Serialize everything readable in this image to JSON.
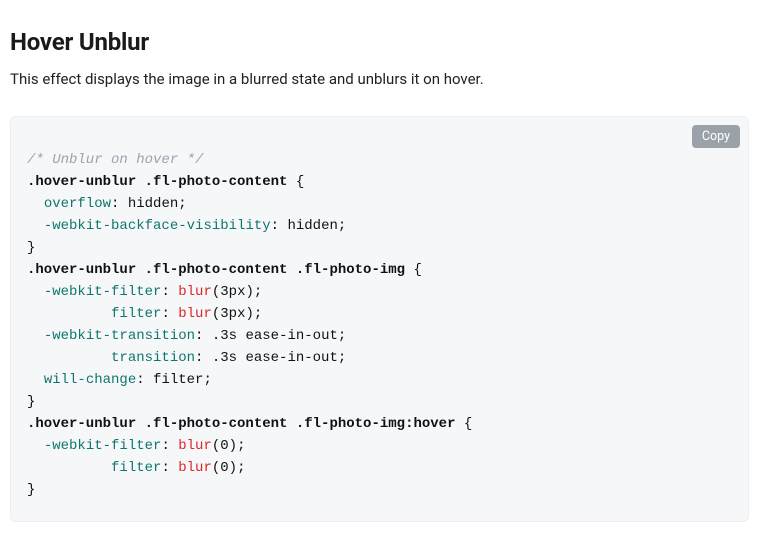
{
  "heading": "Hover Unblur",
  "description": "This effect displays the image in a blurred state and unblurs it on hover.",
  "copy_label": "Copy",
  "code": {
    "comment": "/* Unblur on hover */",
    "rules": [
      {
        "selector": ".hover-unblur .fl-photo-content",
        "decls": [
          {
            "prop": "overflow",
            "value": "hidden"
          },
          {
            "prop": "-webkit-backface-visibility",
            "value": "hidden"
          }
        ]
      },
      {
        "selector": ".hover-unblur .fl-photo-content .fl-photo-img",
        "decls": [
          {
            "prop": "-webkit-filter",
            "func": "blur",
            "args": "3px",
            "align": 0
          },
          {
            "prop": "filter",
            "func": "blur",
            "args": "3px",
            "align": 8
          },
          {
            "prop": "-webkit-transition",
            "value": ".3s ease-in-out",
            "align": 0
          },
          {
            "prop": "transition",
            "value": ".3s ease-in-out",
            "align": 8
          },
          {
            "prop": "will-change",
            "value": "filter"
          }
        ]
      },
      {
        "selector": ".hover-unblur .fl-photo-content .fl-photo-img:hover",
        "decls": [
          {
            "prop": "-webkit-filter",
            "func": "blur",
            "args": "0",
            "align": 0
          },
          {
            "prop": "filter",
            "func": "blur",
            "args": "0",
            "align": 8
          }
        ]
      }
    ]
  }
}
